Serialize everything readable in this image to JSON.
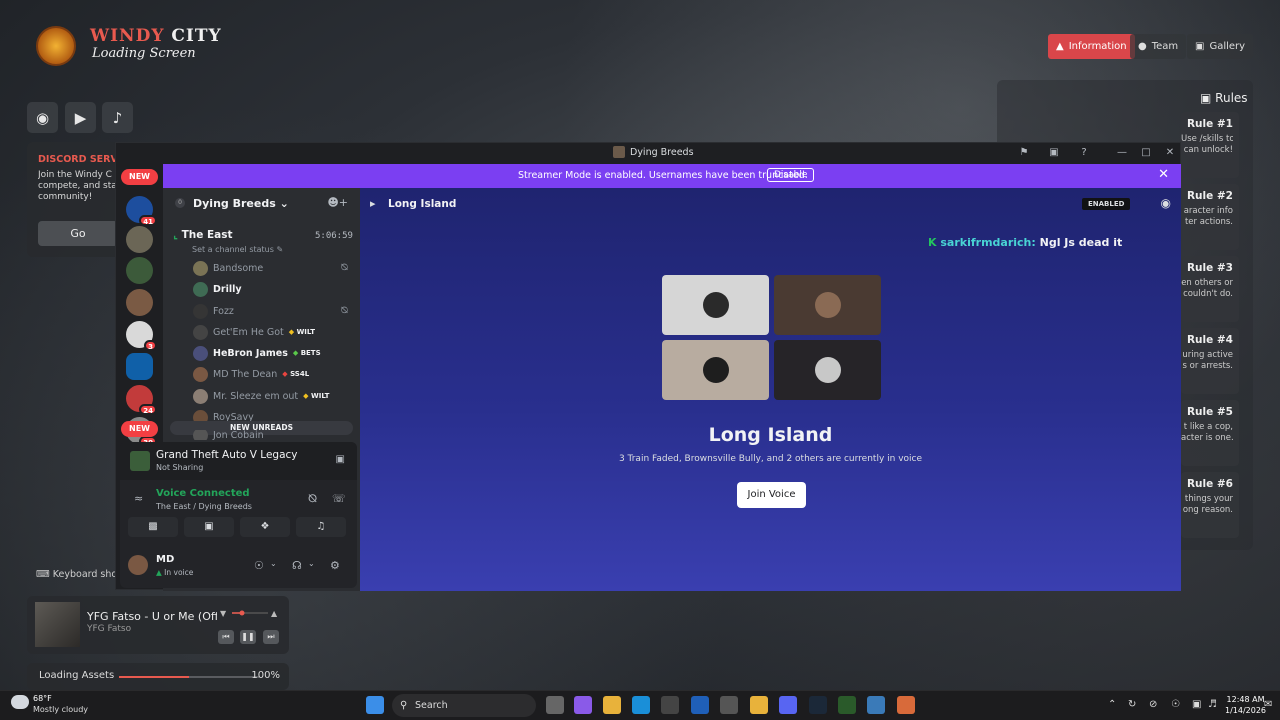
{
  "loading_screen": {
    "title_a": "WINDY",
    "title_b": "CITY",
    "subtitle": "Loading Screen",
    "nav": [
      "Information",
      "Team",
      "Gallery"
    ],
    "discord_panel": {
      "heading": "DISCORD SERV",
      "line1": "Join the Windy C",
      "line2": "compete, and sta",
      "line3": "community!",
      "go": "Go"
    },
    "keyboard": "Keyboard shor",
    "music": {
      "title": "YFG Fatso - U or Me (Offici",
      "artist": "YFG Fatso"
    },
    "loading": {
      "label": "Loading Assets",
      "percent": "100%",
      "progress": 0.5
    },
    "rules_heading": "Rules",
    "rules": [
      {
        "title": "Rule #1",
        "l1": "Use /skills to see your skill points and see what",
        "l2": "can unlock!"
      },
      {
        "title": "Rule #2",
        "l1": "aracter info",
        "l2": "ter actions."
      },
      {
        "title": "Rule #3",
        "l1": "en others or",
        "l2": "couldn't do."
      },
      {
        "title": "Rule #4",
        "l1": "uring active",
        "l2": "s or arrests."
      },
      {
        "title": "Rule #5",
        "l1": "t like a cop,",
        "l2": "acter is one."
      },
      {
        "title": "Rule #6",
        "l1": "things your",
        "l2": "ong reason."
      }
    ]
  },
  "discord": {
    "window_title": "Dying Breeds",
    "banner": {
      "message": "Streamer Mode is enabled. Usernames have been truncated.",
      "disable": "Disable"
    },
    "server_badges": [
      "NEW",
      "41",
      "3",
      "24",
      "30",
      "NEW"
    ],
    "guild": {
      "name": "Dying Breeds",
      "count": "0"
    },
    "voice_channel": {
      "name": "The East",
      "time": "5:06:59",
      "status": "Set a channel status"
    },
    "members": [
      {
        "name": "Bandsome",
        "tag": "",
        "bright": false,
        "muted": true
      },
      {
        "name": "Drilly",
        "tag": "",
        "bright": true,
        "muted": false
      },
      {
        "name": "Fozz",
        "tag": "",
        "bright": false,
        "muted": true
      },
      {
        "name": "Get'Em He Got",
        "tag": "WILT",
        "bright": false,
        "muted": false
      },
      {
        "name": "HeBron James",
        "tag": "BETS",
        "bright": true,
        "muted": false
      },
      {
        "name": "MD The Dean",
        "tag": "SS4L",
        "bright": false,
        "muted": false
      },
      {
        "name": "Mr. Sleeze em out",
        "tag": "WILT",
        "bright": false,
        "muted": false
      },
      {
        "name": "RoySavy",
        "tag": "",
        "bright": false,
        "muted": false
      },
      {
        "name": "Jon Cobain",
        "tag": "",
        "bright": false,
        "muted": false
      }
    ],
    "new_unreads": "NEW UNREADS",
    "activity": {
      "game": "Grand Theft Auto V Legacy",
      "status": "Not Sharing"
    },
    "voice": {
      "status": "Voice Connected",
      "location": "The East / Dying Breeds"
    },
    "user": {
      "name": "MD",
      "status": "In voice"
    },
    "main": {
      "channel": "Long Island",
      "enabled_badge": "ENABLED",
      "chat_prefix": "K",
      "chat_name": "sarkifrmdarich:",
      "chat_text": "Ngl Js dead it",
      "heading": "Long Island",
      "subtext": "3 Train Faded, Brownsville Bully, and 2 others are currently in voice",
      "join": "Join Voice"
    }
  },
  "taskbar": {
    "temp": "68°F",
    "weather": "Mostly cloudy",
    "search": "Search",
    "time": "12:48 AM",
    "date": "1/14/2026"
  },
  "colors": {
    "accent_red": "#e85a4f",
    "discord_purple": "#7b3ff2",
    "voice_green": "#23a55a"
  }
}
